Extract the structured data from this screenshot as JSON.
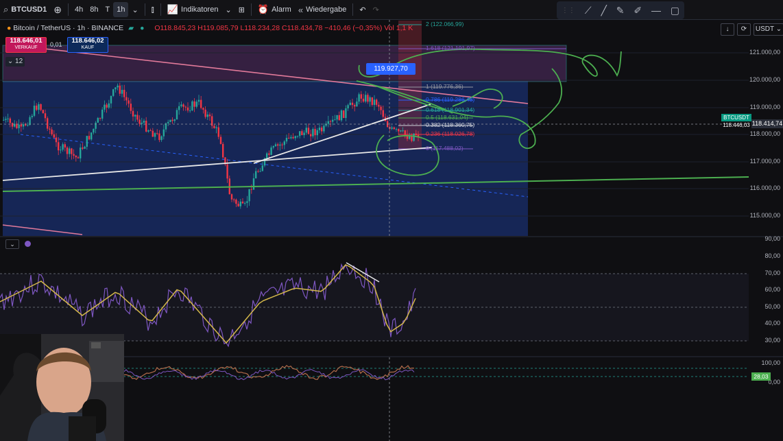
{
  "toolbar": {
    "symbol": "BTCUSD1",
    "timeframes": [
      "4h",
      "8h",
      "T",
      "1h"
    ],
    "active_timeframe": "1h",
    "indicators_label": "Indikatoren",
    "alarm_label": "Alarm",
    "replay_label": "Wiedergabe"
  },
  "legend": {
    "instrument": "Bitcoin / TetherUS · 1h · BINANCE",
    "ohlc": "O118.845,23 H119.085,79 L118.234,28 C118.434,78 −410,46 (−0,35%)",
    "vol_suffix": "Vol 1,1 K"
  },
  "orders": {
    "sell_price": "118.646,01",
    "sell_label": "VERKAUF",
    "spread": "0,01",
    "buy_price": "118.646,02",
    "buy_label": "KAUF"
  },
  "counter": "12",
  "callout_price": "119.927,70",
  "currency": "USDT",
  "price_axis": [
    "121.000,00",
    "120.000,00",
    "119.000,00",
    "118.000,00",
    "117.000,00",
    "116.000,00",
    "115.000,00"
  ],
  "current_price": "118.414,74",
  "symbol_tag": "BTCUSDT 118.446,03",
  "fib_levels": [
    {
      "label": "2 (122.066,99)",
      "color": "#26a69a"
    },
    {
      "label": "1.618 (121.191,97)",
      "color": "#7e57c2"
    },
    {
      "label": "1 (119.776,36)",
      "color": "#9598a1"
    },
    {
      "label": "0.786 (119.286,48)",
      "color": "#2962ff"
    },
    {
      "label": "0.618 (118.901,34)",
      "color": "#26a69a"
    },
    {
      "label": "0.5 (118.631,04)",
      "color": "#4caf50"
    },
    {
      "label": "0.382 (118.360,75)",
      "color": "#d1d4dc"
    },
    {
      "label": "0.236 (118.026,78)",
      "color": "#f23645"
    },
    {
      "label": "0 (117.488,02)",
      "color": "#7e57c2"
    }
  ],
  "rsi_axis": [
    "90,00",
    "80,00",
    "70,00",
    "60,00",
    "50,00",
    "40,00",
    "30,00"
  ],
  "lower_axis": [
    "100,00",
    "0,00"
  ],
  "rsi_value": "28,03",
  "colors": {
    "up": "#26a69a",
    "down": "#f23645",
    "rsi": "#7e57c2",
    "rsi_ma": "#d4b84a",
    "annotation": "#4caf50"
  }
}
